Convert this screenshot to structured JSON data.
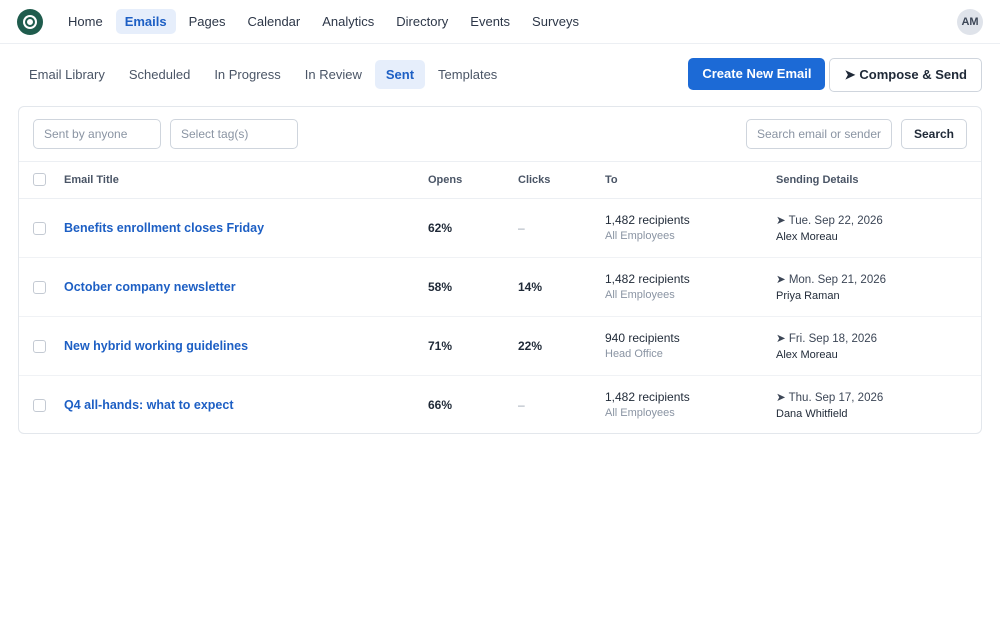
{
  "nav": {
    "items": [
      {
        "label": "Home",
        "active": false
      },
      {
        "label": "Emails",
        "active": true
      },
      {
        "label": "Pages",
        "active": false
      },
      {
        "label": "Calendar",
        "active": false
      },
      {
        "label": "Analytics",
        "active": false
      },
      {
        "label": "Directory",
        "active": false
      },
      {
        "label": "Events",
        "active": false
      },
      {
        "label": "Surveys",
        "active": false
      }
    ],
    "avatar_initials": "AM"
  },
  "tabs": [
    {
      "label": "Email Library",
      "active": false
    },
    {
      "label": "Scheduled",
      "active": false
    },
    {
      "label": "In Progress",
      "active": false
    },
    {
      "label": "In Review",
      "active": false
    },
    {
      "label": "Sent",
      "active": true
    },
    {
      "label": "Templates",
      "active": false
    }
  ],
  "actions": {
    "create_label": "Create New Email",
    "compose_label": "Compose & Send",
    "compose_icon": "➤"
  },
  "filters": {
    "sent_by_placeholder": "Sent by anyone",
    "tags_placeholder": "Select tag(s)",
    "search_placeholder": "Search email or sender",
    "search_label": "Search"
  },
  "table": {
    "headers": {
      "title": "Email Title",
      "opens": "Opens",
      "clicks": "Clicks",
      "to": "To",
      "sending": "Sending Details"
    },
    "rows": [
      {
        "title": "Benefits enrollment closes Friday",
        "opens": "62%",
        "clicks": "–",
        "to": "1,482 recipients",
        "audience": "All Employees",
        "date": "➤ Tue. Sep 22, 2026",
        "sender": "Alex Moreau"
      },
      {
        "title": "October company newsletter",
        "opens": "58%",
        "clicks": "14%",
        "to": "1,482 recipients",
        "audience": "All Employees",
        "date": "➤ Mon. Sep 21, 2026",
        "sender": "Priya Raman"
      },
      {
        "title": "New hybrid working guidelines",
        "opens": "71%",
        "clicks": "22%",
        "to": "940 recipients",
        "audience": "Head Office",
        "date": "➤ Fri. Sep 18, 2026",
        "sender": "Alex Moreau"
      },
      {
        "title": "Q4 all-hands: what to expect",
        "opens": "66%",
        "clicks": "–",
        "to": "1,482 recipients",
        "audience": "All Employees",
        "date": "➤ Thu. Sep 17, 2026",
        "sender": "Dana Whitfield"
      }
    ]
  },
  "colors": {
    "accent": "#1c6ad6",
    "logo": "#1f5c4d",
    "active_tab_bg": "#e6eefb"
  }
}
